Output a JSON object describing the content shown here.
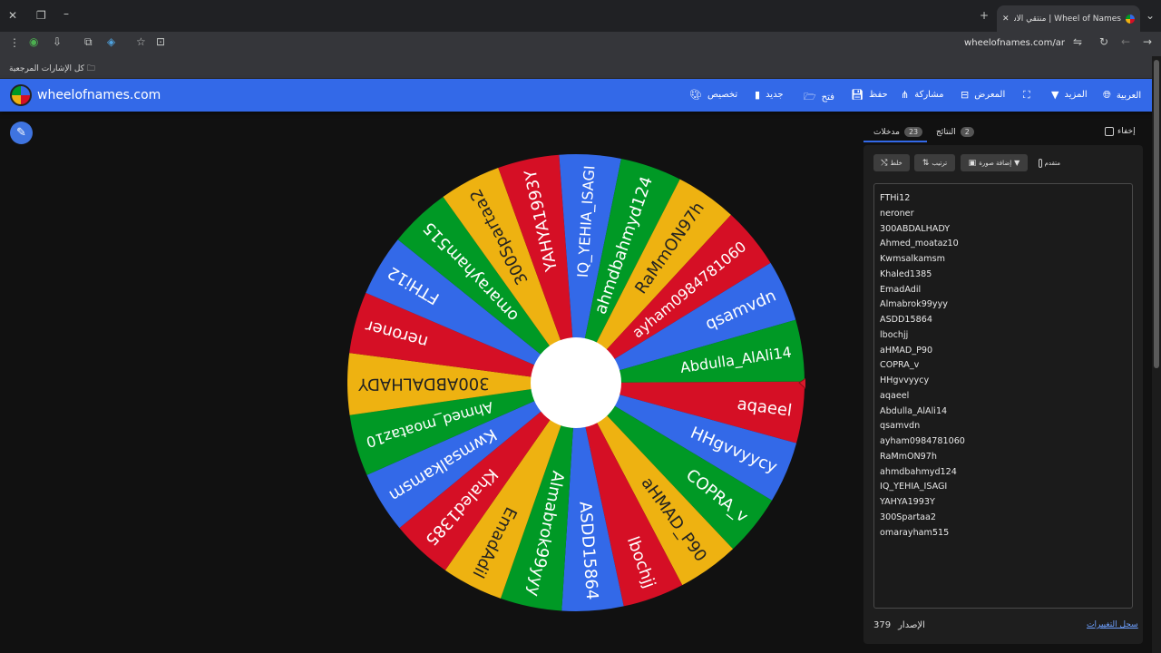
{
  "browser": {
    "tab_title": "Wheel of Names | منتقي الاسم العشوائي",
    "url": "wheelofnames.com/ar",
    "bookmarks_label": "كل الإشارات المرجعية"
  },
  "app": {
    "brand": "wheelofnames.com",
    "menu": [
      {
        "label": "تخصيص",
        "icon": "palette-icon"
      },
      {
        "label": "جديد",
        "icon": "file-icon"
      },
      {
        "label": "فتح",
        "icon": "folder-icon"
      },
      {
        "label": "حفظ",
        "icon": "save-icon"
      },
      {
        "label": "مشاركة",
        "icon": "share-icon"
      },
      {
        "label": "المعرض",
        "icon": "gallery-icon"
      },
      {
        "label": "",
        "icon": "fullscreen-icon"
      },
      {
        "label": "المزيد",
        "icon": "caret-down-icon"
      },
      {
        "label": "العربية",
        "icon": "globe-icon"
      }
    ]
  },
  "wheel": {
    "colors": [
      "#3369e8",
      "#d50f25",
      "#eeb211",
      "#009925"
    ],
    "selected": "aqaeel",
    "slices": [
      "aqaeel",
      "HHgvvyycy",
      "COPRA_v",
      "aHMAD_P90",
      "lbochjj",
      "ASDD15864",
      "Almabrok99yyy",
      "EmadAdil",
      "Khaled1385",
      "Kwmsalkamsm",
      "Ahmed_moataz10",
      "300ABDALHADY",
      "neroner",
      "FTHi12",
      "omarayham515",
      "300Spartaa2",
      "YAHYA1993Y",
      "IQ_YEHIA_ISAGI",
      "ahmdbahmyd124",
      "RaMmON97h",
      "ayham0984781060",
      "qsamvdn",
      "Abdulla_AlAli14"
    ]
  },
  "panel": {
    "tabs": {
      "entries_label": "مدخلات",
      "entries_count": "23",
      "results_label": "النتائج",
      "results_count": "2"
    },
    "hide_label": "إخفاء",
    "toolbar": {
      "shuffle": "خلط",
      "sort": "ترتيب",
      "add_image": "إضافة صورة",
      "advanced": "متقدم"
    },
    "entries": [
      "FTHi12",
      "neroner",
      "300ABDALHADY",
      "Ahmed_moataz10",
      "Kwmsalkamsm",
      "Khaled1385",
      "EmadAdil",
      "Almabrok99yyy",
      "ASDD15864",
      "lbochjj",
      "aHMAD_P90",
      "COPRA_v",
      "HHgvvyycy",
      "aqaeel",
      "Abdulla_AlAli14",
      "qsamvdn",
      "ayham0984781060",
      "RaMmON97h",
      "ahmdbahmyd124",
      "IQ_YEHIA_ISAGI",
      "YAHYA1993Y",
      "300Spartaa2",
      "omarayham515"
    ],
    "version_label": "الإصدار",
    "version_number": "379",
    "changelog_label": "سجل التغييرات"
  }
}
